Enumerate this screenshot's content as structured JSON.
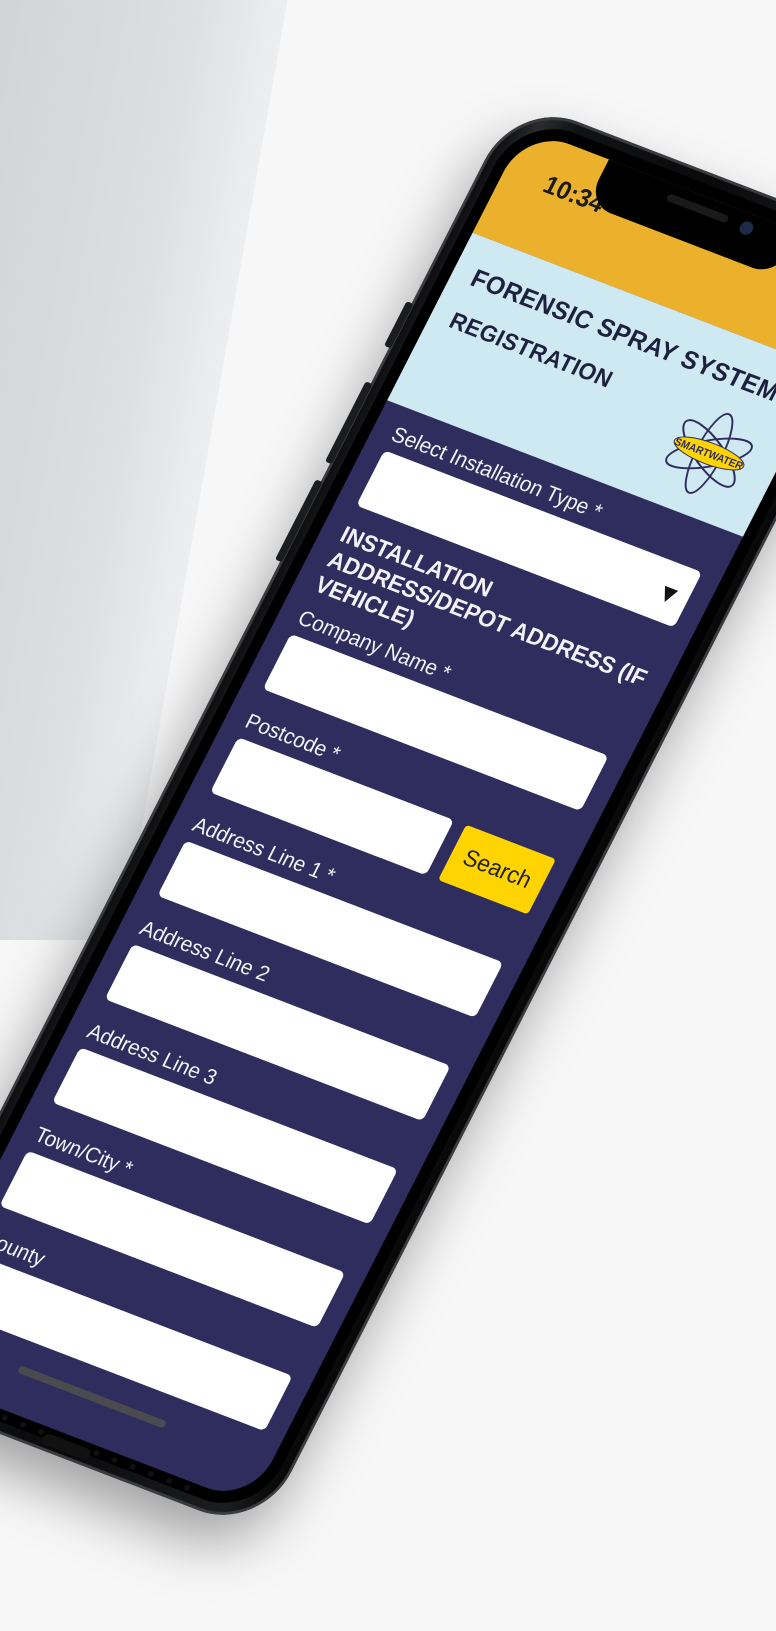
{
  "status_bar": {
    "time": "10:34",
    "wifi_icon": "wifi-icon",
    "battery_icon": "battery-icon"
  },
  "header": {
    "app_title": "FORENSIC SPRAY SYSTEM",
    "page_title": "REGISTRATION",
    "menu_icon": "kebab-menu-icon",
    "logo_text": "SMARTWATER"
  },
  "form": {
    "installation_type_label": "Select Installation Type *",
    "installation_type_value": "",
    "section_heading": "INSTALLATION ADDRESS/DEPOT ADDRESS (IF VEHICLE)",
    "fields": [
      {
        "label": "Company Name *",
        "value": ""
      },
      {
        "label": "Postcode *",
        "value": ""
      },
      {
        "label": "Address Line 1 *",
        "value": ""
      },
      {
        "label": "Address Line 2",
        "value": ""
      },
      {
        "label": "Address Line 3",
        "value": ""
      },
      {
        "label": "Town/City *",
        "value": ""
      },
      {
        "label": "County",
        "value": ""
      }
    ],
    "search_label": "Search"
  },
  "colors": {
    "status_bar": "#ebb12d",
    "header": "#cfe9f2",
    "form_bg": "#2f2c5e",
    "search_button": "#ffd400"
  }
}
